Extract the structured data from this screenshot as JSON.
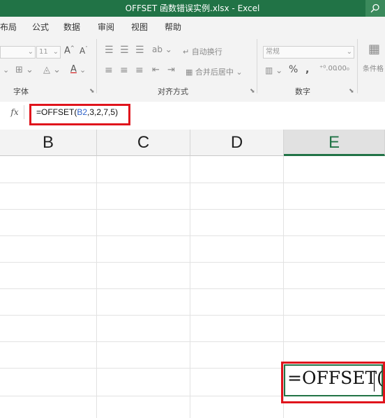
{
  "window": {
    "title": "OFFSET 函数错误实例.xlsx  -  Excel"
  },
  "menu": {
    "items": [
      "布局",
      "公式",
      "数据",
      "审阅",
      "视图",
      "帮助"
    ]
  },
  "ribbon": {
    "font_group_label": "字体",
    "font_size": "11",
    "align_group_label": "对齐方式",
    "wrap_text": "自动换行",
    "merge_center": "合并后居中",
    "number_group_label": "数字",
    "number_format": "常规",
    "percent": "%",
    "conditional_format": "条件格"
  },
  "formula_bar": {
    "fx": "fx",
    "prefix": "=OFFSET(",
    "ref": "B2",
    "suffix": ",3,2,7,5)"
  },
  "columns": [
    "B",
    "C",
    "D",
    "E"
  ],
  "active_cell": {
    "column": "E",
    "edit_text": "=OFFSET("
  },
  "colors": {
    "excel_green": "#217346",
    "highlight_red": "#e0141c",
    "ref_blue": "#2f62c9"
  }
}
